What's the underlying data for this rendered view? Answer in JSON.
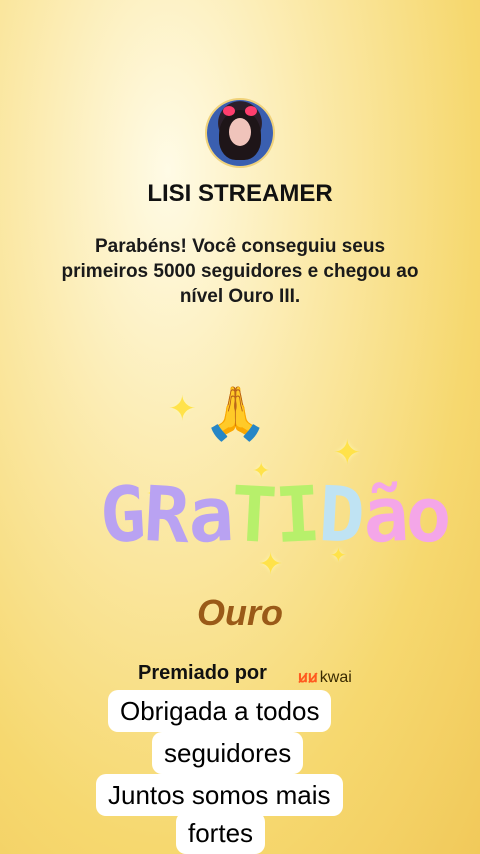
{
  "profile": {
    "name": "LISI STREAMER",
    "avatar_icon": "profile-photo"
  },
  "message": "Parabéns! Você conseguiu seus primeiros 5000 seguidores e chegou ao nível Ouro III.",
  "sticker": {
    "letters": [
      "G",
      "R",
      "a",
      "T",
      "I",
      "D",
      "ã",
      "o"
    ],
    "letter_colors": [
      "#b9a2f2",
      "#b9a2f2",
      "#b9a2f2",
      "#b7f06b",
      "#b7f06b",
      "#bfe3f3",
      "#f4a6e8",
      "#f4a6e8"
    ],
    "hands_icon": "praying-hands-icon",
    "hands_glyph": "🙏",
    "sparkle_glyph": "✦"
  },
  "level": "Ouro",
  "awarded_by": {
    "label": "Premiado por",
    "brand_mark": "ꞹꞹ",
    "brand": "kwai"
  },
  "caption": {
    "lines": [
      "Obrigada a todos",
      "seguidores",
      "Juntos somos mais",
      "fortes"
    ]
  },
  "colors": {
    "background": "#f6d86f",
    "level_text": "#9a5a18",
    "kwai_brand": "#ff5a1f"
  }
}
